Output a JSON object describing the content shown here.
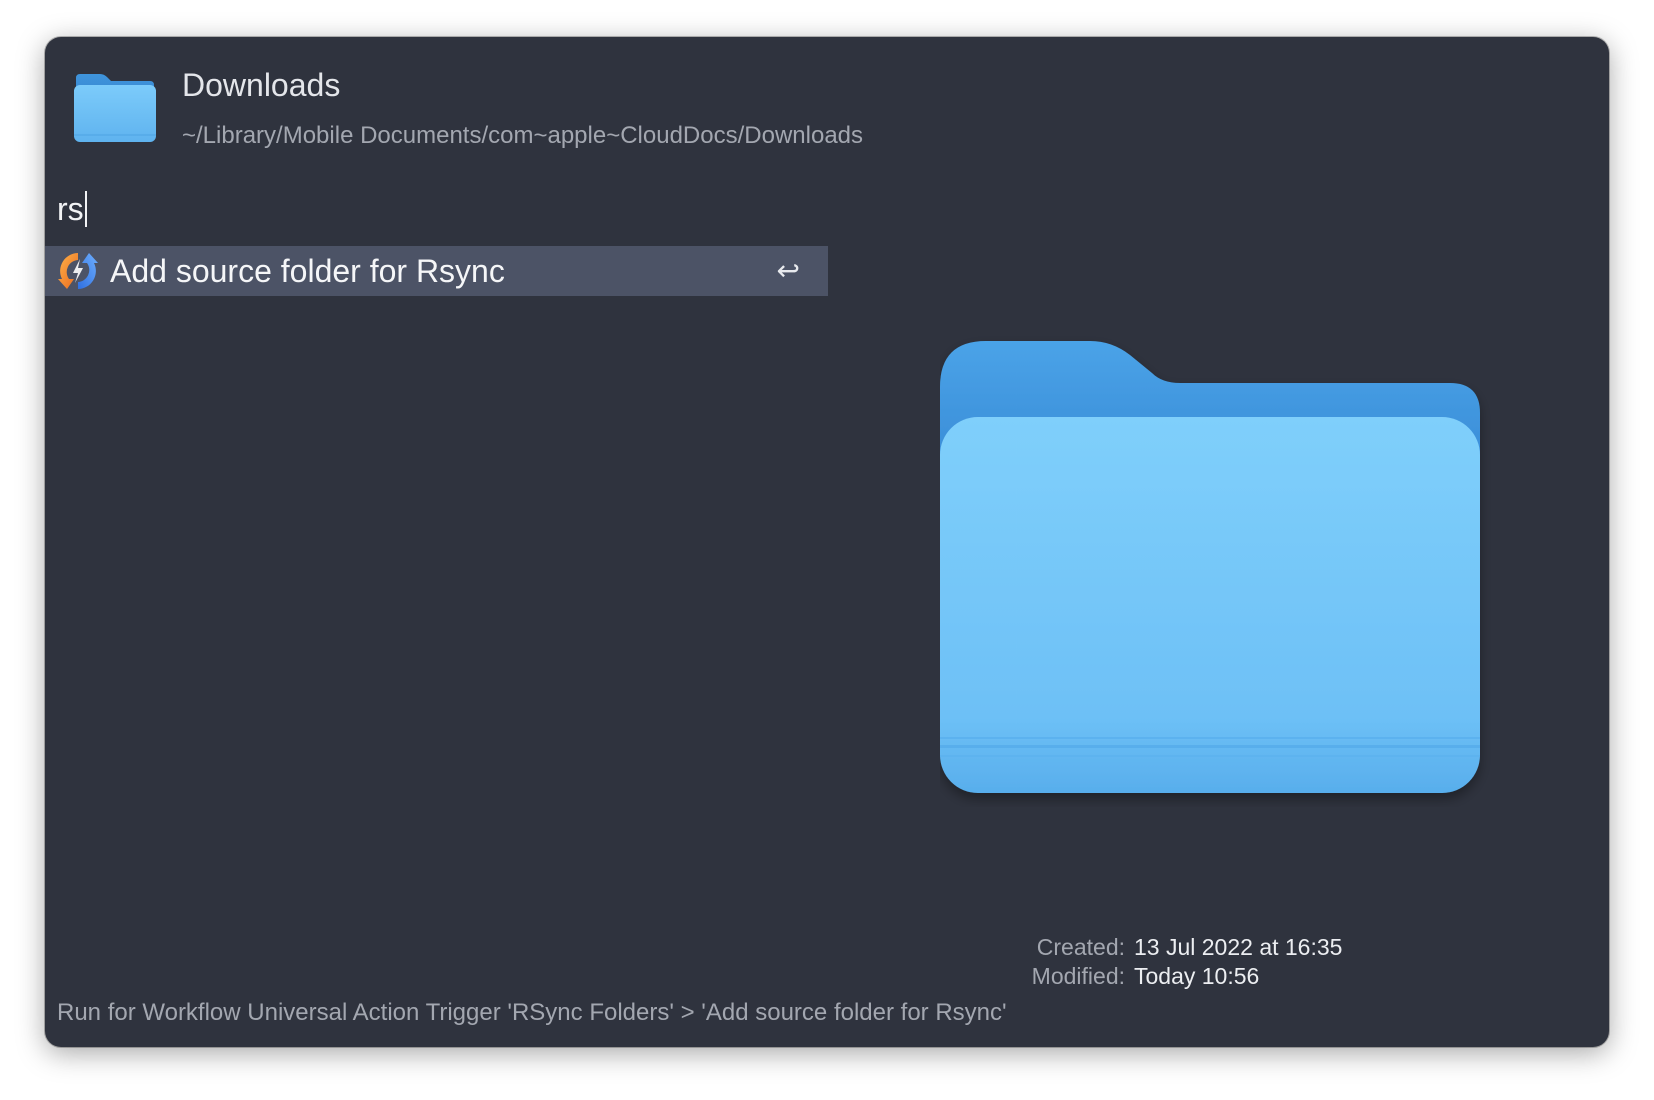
{
  "header": {
    "title": "Downloads",
    "path": "~/Library/Mobile Documents/com~apple~CloudDocs/Downloads",
    "icon": "folder-icon"
  },
  "search": {
    "query": "rs"
  },
  "results": [
    {
      "label": "Add source folder for Rsync",
      "icon": "rsync-icon",
      "shortcut": "↩",
      "selected": true
    }
  ],
  "preview": {
    "icon": "folder-icon",
    "created_label": "Created:",
    "created_value": "13 Jul 2022 at 16:35",
    "modified_label": "Modified:",
    "modified_value": "Today 10:56"
  },
  "footer": {
    "text": "Run for Workflow Universal Action Trigger 'RSync Folders' > 'Add source folder for Rsync'"
  },
  "colors": {
    "background": "#2f333e",
    "selection": "#4c5366",
    "folder_blue": "#5eb4f0"
  }
}
